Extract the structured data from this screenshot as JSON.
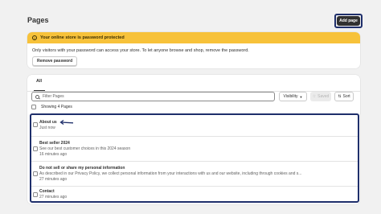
{
  "header": {
    "title": "Pages",
    "add_page_label": "Add page"
  },
  "banner": {
    "title": "Your online store is password protected",
    "body": "Only visitors with your password can access your store. To let anyone browse and shop, remove the password.",
    "remove_password_label": "Remove password",
    "icon": "alert-circle-icon"
  },
  "tabs": [
    {
      "label": "All"
    }
  ],
  "toolbar": {
    "filter_placeholder": "Filter Pages",
    "visibility_label": "Visibility",
    "saved_label": "Saved",
    "sort_label": "Sort"
  },
  "list": {
    "count_label": "Showing 4 Pages",
    "rows": [
      {
        "title": "About us",
        "subtitle": "Just now"
      },
      {
        "title": "Best seller 2024",
        "subtitle": "See our best customer choices in this 2024 season",
        "time": "16 minutes ago"
      },
      {
        "title": "Do not sell or share my personal information",
        "subtitle": "As described in our Privacy Policy, we collect personal information from your interactions with us and our website, including through cookies and s...",
        "time": "27 minutes ago"
      },
      {
        "title": "Contact",
        "subtitle": "27 minutes ago"
      }
    ]
  },
  "colors": {
    "banner": "#f7c23a",
    "highlight_frame": "#1f2f6b",
    "primary_button": "#303030"
  }
}
